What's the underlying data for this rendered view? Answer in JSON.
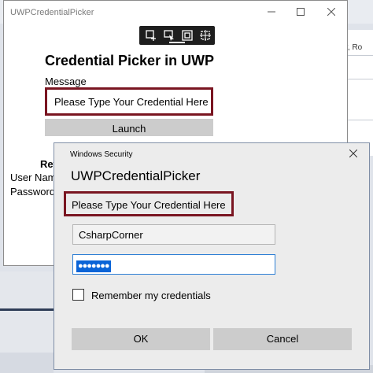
{
  "background": {
    "right_panel_text": "der, Ro"
  },
  "app": {
    "window_title": "UWPCredentialPicker",
    "heading": "Credential Picker in UWP",
    "message_label": "Message",
    "message_value": "Please Type Your Credential Here",
    "launch_label": "Launch",
    "returned_label": "Ret",
    "username_label": "User Nam",
    "password_label": "Password"
  },
  "dialog": {
    "title": "Windows Security",
    "heading": "UWPCredentialPicker",
    "message": "Please Type Your Credential Here",
    "username_value": "CsharpCorner",
    "password_mask": "●●●●●●●",
    "remember_label": "Remember my credentials",
    "remember_checked": false,
    "ok_label": "OK",
    "cancel_label": "Cancel"
  },
  "icons": {
    "minimize": "minimize-icon",
    "maximize": "maximize-icon",
    "close": "close-icon"
  },
  "colors": {
    "highlight_border": "#7a1521",
    "selection": "#0a64d7",
    "button_bg": "#cccccc"
  }
}
